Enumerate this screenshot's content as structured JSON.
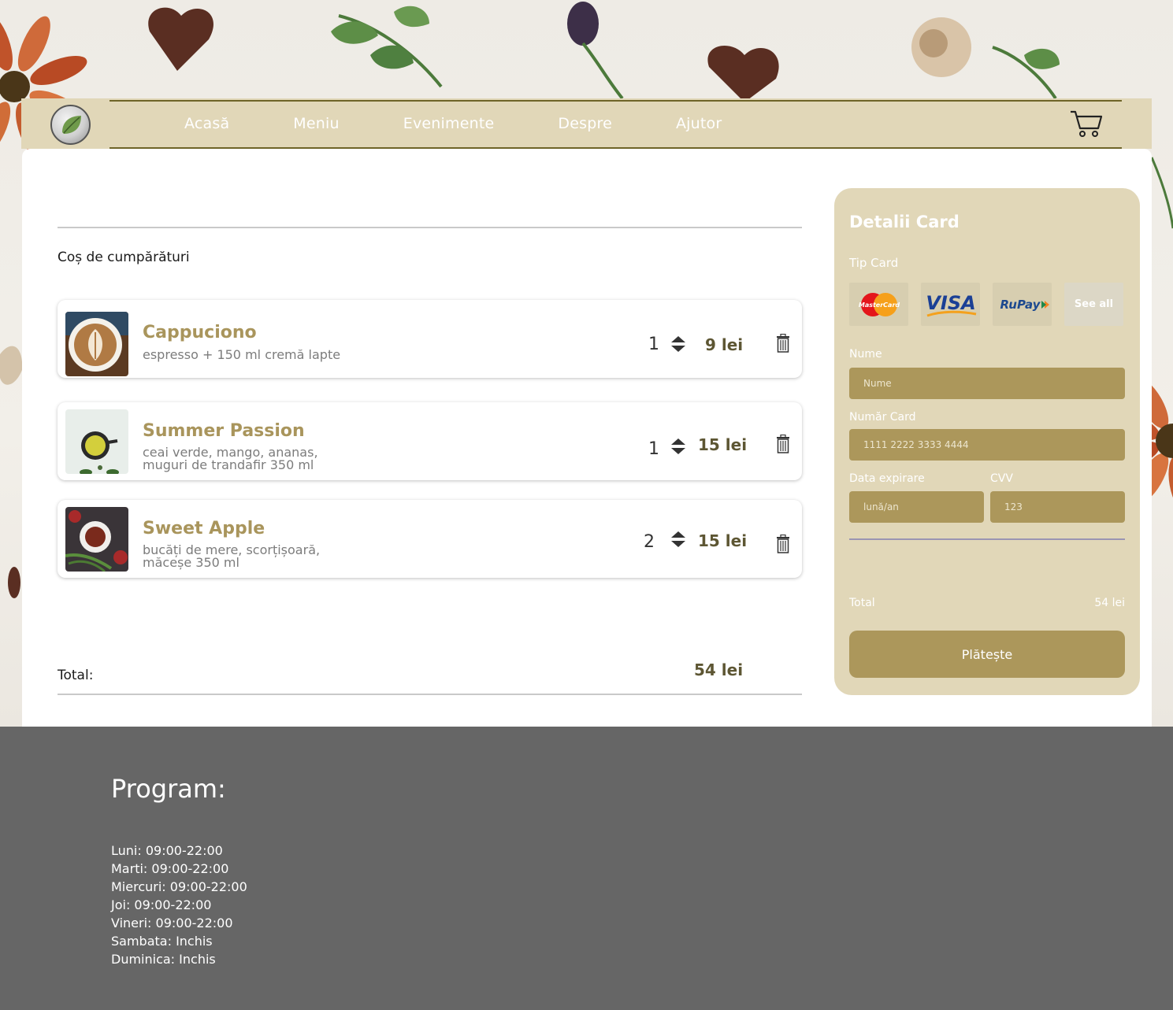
{
  "nav": {
    "items": [
      "Acasă",
      "Meniu",
      "Evenimente",
      "Despre",
      "Ajutor"
    ]
  },
  "cart": {
    "title": "Coș de cumpărături",
    "items": [
      {
        "name": "Cappuciono",
        "desc": "espresso + 150 ml cremă lapte",
        "qty": "1",
        "price": "9 lei"
      },
      {
        "name": "Summer Passion",
        "desc": "ceai verde, mango, ananas, muguri de trandafir 350 ml",
        "qty": "1",
        "price": "15 lei"
      },
      {
        "name": "Sweet Apple",
        "desc": "bucăți de mere, scorțișoară, măceșe 350 ml",
        "qty": "2",
        "price": "15 lei"
      }
    ],
    "total_label": "Total:",
    "total_value": "54 lei"
  },
  "card_panel": {
    "title": "Detalii Card",
    "card_type_label": "Tip Card",
    "card_types": [
      "MasterCard",
      "VISA",
      "RuPay",
      "See all"
    ],
    "name_label": "Nume",
    "name_placeholder": "Nume",
    "number_label": "Număr Card",
    "number_placeholder": "1111 2222 3333 4444",
    "expiry_label": "Data expirare",
    "expiry_placeholder": "lună/an",
    "cvv_label": "CVV",
    "cvv_placeholder": "123",
    "total_label": "Total",
    "total_value": "54 lei",
    "pay_label": "Plătește"
  },
  "footer": {
    "title": "Program:",
    "hours": [
      "Luni: 09:00-22:00",
      "Marti: 09:00-22:00",
      "Miercuri: 09:00-22:00",
      "Joi: 09:00-22:00",
      "Vineri: 09:00-22:00",
      "Sambata: Inchis",
      "Duminica: Inchis"
    ]
  },
  "colors": {
    "accent": "#ac975b",
    "panel": "#e1d7b8",
    "nav": "#e1d7b8",
    "item_name": "#a9955c",
    "price": "#5d5633",
    "footer": "#666666"
  }
}
